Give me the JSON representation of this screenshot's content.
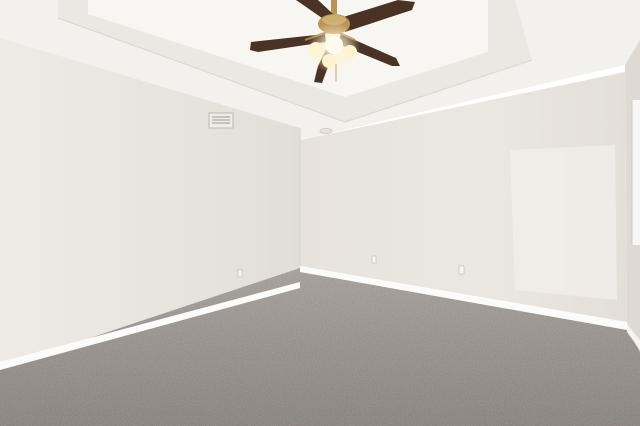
{
  "scene": {
    "subject": "empty room",
    "elements": [
      "ceiling-fan",
      "tray-ceiling",
      "hvac-vent",
      "smoke-detector",
      "window",
      "electrical-outlet",
      "baseboard",
      "carpet"
    ],
    "colors": {
      "wall_left": "#e6e2dc",
      "wall_back": "#e4e0d9",
      "ceiling": "#f3f1ee",
      "baseboard": "#fbfbfa",
      "carpet": "#8f8781",
      "fan_blade": "#4a3324",
      "fan_brass": "#b9935a",
      "fan_light": "#fff4d2"
    }
  }
}
